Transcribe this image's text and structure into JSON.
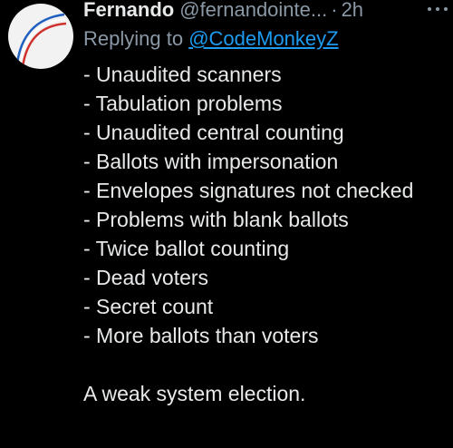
{
  "tweet": {
    "author_name": "Fernando",
    "author_handle": "@fernandointe...",
    "separator": "·",
    "time": "2h",
    "reply_prefix": "Replying to ",
    "reply_to": "@CodeMonkeyZ",
    "lines": [
      "- Unaudited scanners",
      "- Tabulation problems",
      "- Unaudited central counting",
      "- Ballots with impersonation",
      "- Envelopes signatures not checked",
      "- Problems with blank ballots",
      "- Twice ballot counting",
      "- Dead voters",
      "- Secret count",
      "- More ballots than voters"
    ],
    "closing": "A weak system election."
  },
  "icons": {
    "more": "more-horizontal-icon"
  },
  "colors": {
    "background": "#000000",
    "text": "#e7e9ea",
    "muted": "#8b98a5",
    "link": "#1d9bf0"
  }
}
